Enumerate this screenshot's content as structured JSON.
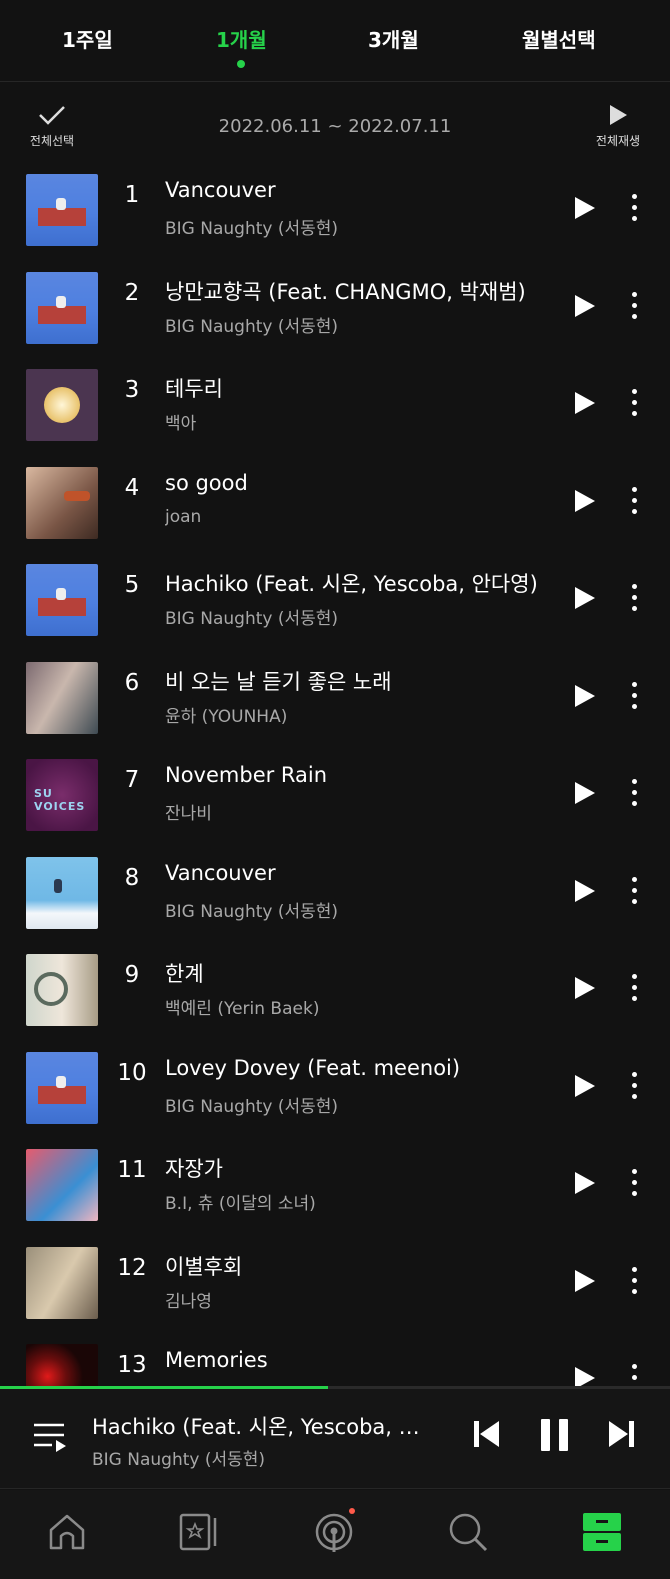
{
  "tabs": [
    {
      "label": "1주일",
      "active": false
    },
    {
      "label": "1개월",
      "active": true
    },
    {
      "label": "3개월",
      "active": false
    },
    {
      "label": "월별선택",
      "active": false
    }
  ],
  "toolbar": {
    "select_all_label": "전체선택",
    "date_range": "2022.06.11 ~ 2022.07.11",
    "play_all_label": "전체재생"
  },
  "tracks": [
    {
      "rank": "1",
      "title": "Vancouver",
      "artist": "BIG Naughty (서동현)"
    },
    {
      "rank": "2",
      "title": "낭만교향곡 (Feat. CHANGMO, 박재범)",
      "artist": "BIG Naughty (서동현)"
    },
    {
      "rank": "3",
      "title": "테두리",
      "artist": "백아"
    },
    {
      "rank": "4",
      "title": "so good",
      "artist": "joan"
    },
    {
      "rank": "5",
      "title": "Hachiko (Feat. 시온, Yescoba, 안다영)",
      "artist": "BIG Naughty (서동현)"
    },
    {
      "rank": "6",
      "title": "비 오는 날 듣기 좋은 노래",
      "artist": "윤하 (YOUNHA)"
    },
    {
      "rank": "7",
      "title": "November Rain",
      "artist": "잔나비"
    },
    {
      "rank": "8",
      "title": "Vancouver",
      "artist": "BIG Naughty (서동현)"
    },
    {
      "rank": "9",
      "title": "한계",
      "artist": "백예린 (Yerin Baek)"
    },
    {
      "rank": "10",
      "title": "Lovey Dovey (Feat. meenoi)",
      "artist": "BIG Naughty (서동현)"
    },
    {
      "rank": "11",
      "title": "자장가",
      "artist": "B.I, 츄 (이달의 소녀)"
    },
    {
      "rank": "12",
      "title": "이별후회",
      "artist": "김나영"
    },
    {
      "rank": "13",
      "title": "Memories",
      "artist": ""
    }
  ],
  "album_art_text": {
    "track7": "SU VOICES"
  },
  "now_playing": {
    "title": "Hachiko (Feat. 시온, Yescoba, 안다영)",
    "artist": "BIG Naughty (서동현)",
    "progress": 0.49
  },
  "nav": [
    "home-icon",
    "library-card-icon",
    "podcast-icon",
    "search-icon",
    "my-storage-icon"
  ],
  "colors": {
    "accent": "#26d24a",
    "background": "#121212",
    "badge": "#ff5a4a"
  }
}
